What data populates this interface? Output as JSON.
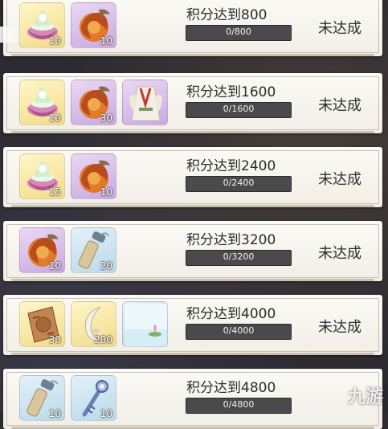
{
  "rewards": [
    {
      "title": "积分达到800",
      "progress": "0/800",
      "progress_fraction": 0,
      "status": "未达成",
      "items": [
        {
          "icon": "lotus-bowl-icon",
          "rarity": "yellow",
          "qty": "10"
        },
        {
          "icon": "fire-orb-icon",
          "rarity": "purple",
          "qty": "10"
        }
      ]
    },
    {
      "title": "积分达到1600",
      "progress": "0/1600",
      "progress_fraction": 0,
      "status": "未达成",
      "items": [
        {
          "icon": "lotus-bowl-icon",
          "rarity": "yellow",
          "qty": "10"
        },
        {
          "icon": "fire-orb-icon",
          "rarity": "purple",
          "qty": "30"
        },
        {
          "icon": "costume-icon",
          "rarity": "purple",
          "qty": ""
        }
      ]
    },
    {
      "title": "积分达到2400",
      "progress": "0/2400",
      "progress_fraction": 0,
      "status": "未达成",
      "items": [
        {
          "icon": "lotus-bowl-icon",
          "rarity": "yellow",
          "qty": "15"
        },
        {
          "icon": "fire-orb-icon",
          "rarity": "purple",
          "qty": "10"
        }
      ]
    },
    {
      "title": "积分达到3200",
      "progress": "0/3200",
      "progress_fraction": 0,
      "status": "未达成",
      "items": [
        {
          "icon": "fire-orb-icon",
          "rarity": "purple",
          "qty": "10"
        },
        {
          "icon": "scroll-icon",
          "rarity": "blue",
          "qty": "20"
        }
      ]
    },
    {
      "title": "积分达到4000",
      "progress": "0/4000",
      "progress_fraction": 0,
      "status": "未达成",
      "items": [
        {
          "icon": "bronze-token-icon",
          "rarity": "yellow",
          "qty": "30"
        },
        {
          "icon": "crescent-jade-icon",
          "rarity": "yellow",
          "qty": "200"
        },
        {
          "icon": "lotus-pond-frame-icon",
          "rarity": "blue",
          "qty": ""
        }
      ]
    },
    {
      "title": "积分达到4800",
      "progress": "0/4800",
      "progress_fraction": 0,
      "status": "",
      "items": [
        {
          "icon": "scroll-icon",
          "rarity": "blue",
          "qty": "10"
        },
        {
          "icon": "key-staff-icon",
          "rarity": "blue",
          "qty": "10"
        }
      ]
    }
  ],
  "colors": {
    "card_bg": "#f6f3ec",
    "bar_bg": "#4a4a4c",
    "rarity_yellow": "#f2dc8a",
    "rarity_purple": "#c9a9e0",
    "rarity_blue": "#b9d9ea"
  },
  "watermark": "九游"
}
